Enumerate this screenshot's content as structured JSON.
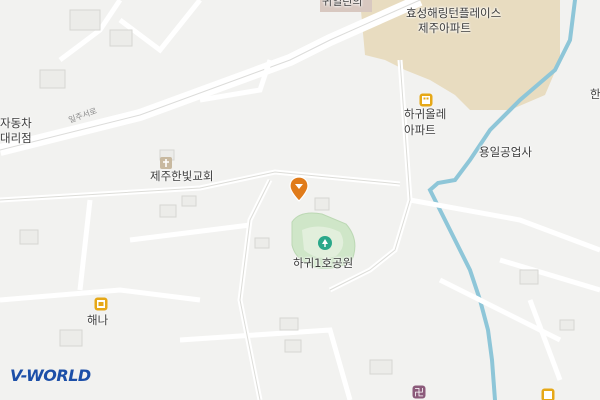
{
  "map": {
    "labels": {
      "apt_hyosung_1": "효성해링턴플레이스",
      "apt_hyosung_2": "제주아파트",
      "apt_hagwi_1": "하귀올레",
      "apt_hagwi_2": "아파트",
      "factory": "용일공업사",
      "church": "제주한빛교회",
      "park": "하귀1호공원",
      "store": "해나",
      "left_1": "자동차",
      "left_2": "대리점",
      "top_building": "귀일린의",
      "right_edge": "한",
      "road": "일주서로"
    },
    "icons": {
      "apartment": "apartment-icon",
      "church": "church-icon",
      "park": "park-icon",
      "store": "store-icon",
      "temple": "temple-icon",
      "location": "location-pin-icon"
    },
    "colors": {
      "background": "#f2f2f0",
      "apartment_area": "#e8dcc0",
      "park_area": "#cfe6c8",
      "stream": "#8ec6d8",
      "pin": "#e07b1a",
      "poi_gold": "#e6a817",
      "logo_blue": "#1c4fa8"
    },
    "logo": {
      "v": "V",
      "world": "-WORLD"
    }
  }
}
